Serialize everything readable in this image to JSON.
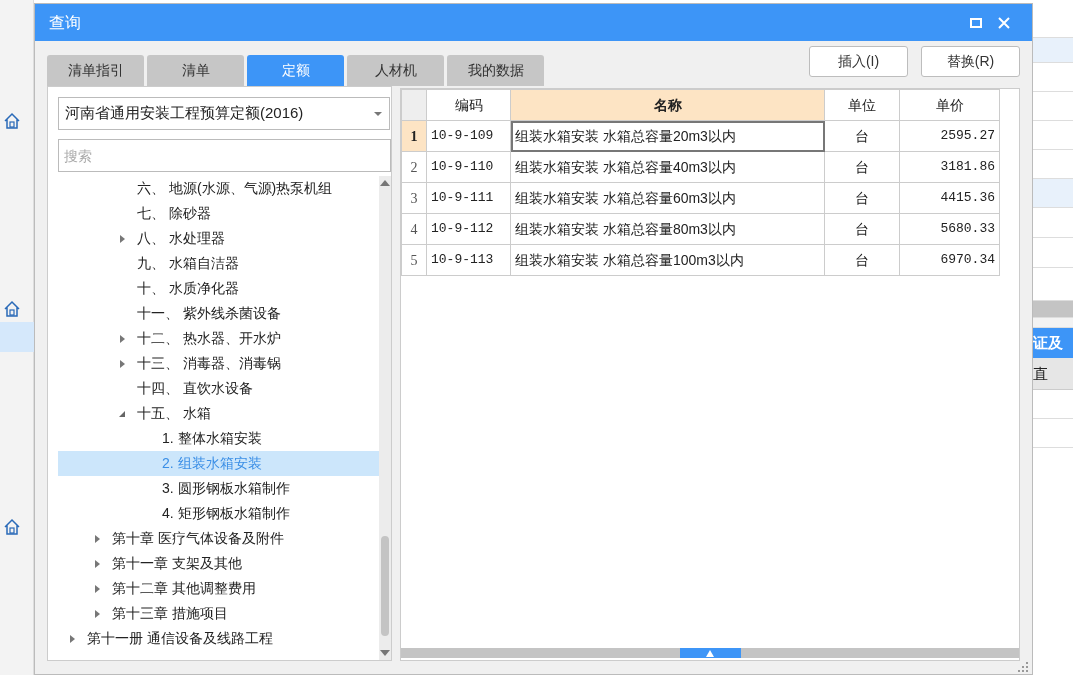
{
  "window": {
    "title": "查询"
  },
  "tabs": [
    {
      "label": "清单指引",
      "selected": false
    },
    {
      "label": "清单",
      "selected": false
    },
    {
      "label": "定额",
      "selected": true
    },
    {
      "label": "人材机",
      "selected": false
    },
    {
      "label": "我的数据",
      "selected": false
    }
  ],
  "buttons": [
    "插入(I)",
    "替换(R)"
  ],
  "library_select": {
    "value": "河南省通用安装工程预算定额(2016)"
  },
  "search": {
    "placeholder": "搜索"
  },
  "tree": {
    "children": [
      {
        "children": [
          {
            "children": [
              {
                "label": "六、 地源(水源、气源)热泵机组",
                "selected": false
              },
              {
                "label": "七、 除砂器",
                "selected": false
              },
              {
                "label": "八、 水处理器",
                "selected": false,
                "expanded": false
              },
              {
                "label": "九、 水箱自洁器",
                "selected": false
              },
              {
                "label": "十、 水质净化器",
                "selected": false
              },
              {
                "label": "十一、 紫外线杀菌设备",
                "selected": false
              },
              {
                "label": "十二、 热水器、开水炉",
                "selected": false,
                "expanded": false
              },
              {
                "label": "十三、 消毒器、消毒锅",
                "selected": false,
                "expanded": false
              },
              {
                "label": "十四、 直饮水设备",
                "selected": false
              },
              {
                "label": "十五、 水箱",
                "selected": false,
                "expanded": true,
                "children": [
                  {
                    "label": "1. 整体水箱安装",
                    "selected": false
                  },
                  {
                    "label": "2. 组装水箱安装",
                    "selected": true
                  },
                  {
                    "label": "3. 圆形钢板水箱制作",
                    "selected": false
                  },
                  {
                    "label": "4. 矩形钢板水箱制作",
                    "selected": false
                  }
                ]
              }
            ]
          },
          {
            "label": "第十章 医疗气体设备及附件",
            "selected": false,
            "expanded": false
          },
          {
            "label": "第十一章 支架及其他",
            "selected": false,
            "expanded": false
          },
          {
            "label": "第十二章 其他调整费用",
            "selected": false,
            "expanded": false
          },
          {
            "label": "第十三章 措施项目",
            "selected": false,
            "expanded": false
          }
        ]
      },
      {
        "label": "第十一册 通信设备及线路工程",
        "selected": false,
        "expanded": false
      }
    ]
  },
  "table": {
    "columns": [
      {
        "label": "编码",
        "selected": false
      },
      {
        "label": "名称",
        "selected": true
      },
      {
        "label": "单位",
        "selected": false
      },
      {
        "label": "单价",
        "selected": false
      }
    ],
    "rows": [
      {
        "number": "1",
        "code": "10-9-109",
        "name": "组装水箱安装  水箱总容量20m3以内",
        "unit": "台",
        "price": "2595.27",
        "selected": true
      },
      {
        "number": "2",
        "code": "10-9-110",
        "name": "组装水箱安装  水箱总容量40m3以内",
        "unit": "台",
        "price": "3181.86",
        "selected": false
      },
      {
        "number": "3",
        "code": "10-9-111",
        "name": "组装水箱安装  水箱总容量60m3以内",
        "unit": "台",
        "price": "4415.36",
        "selected": false
      },
      {
        "number": "4",
        "code": "10-9-112",
        "name": "组装水箱安装  水箱总容量80m3以内",
        "unit": "台",
        "price": "5680.33",
        "selected": false
      },
      {
        "number": "5",
        "code": "10-9-113",
        "name": "组装水箱安装  水箱总容量100m3以内",
        "unit": "台",
        "price": "6970.34",
        "selected": false
      }
    ]
  },
  "background_panel": {
    "header": "证及",
    "cell": "直"
  }
}
